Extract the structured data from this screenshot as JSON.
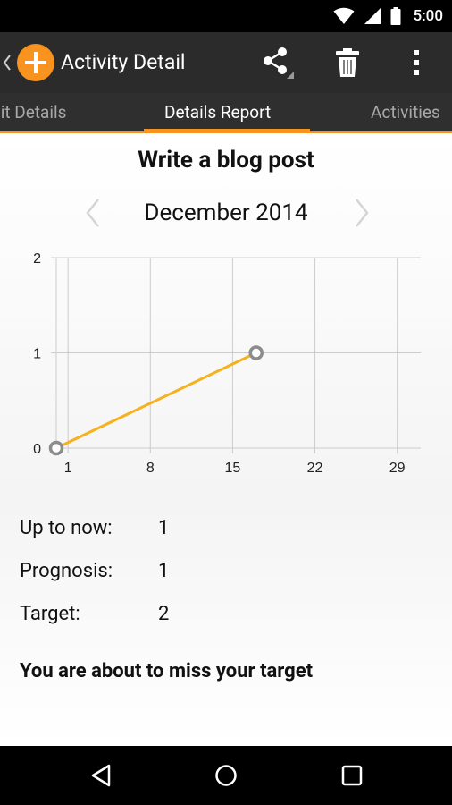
{
  "status_bar": {
    "time": "5:00",
    "icons": [
      "wifi-icon",
      "signal-icon",
      "battery-icon"
    ]
  },
  "action_bar": {
    "title": "Activity Detail",
    "icons": [
      "chevron-left-icon",
      "add-icon",
      "share-icon",
      "trash-icon",
      "overflow-menu-icon"
    ]
  },
  "tabs": [
    {
      "label": "Edit Details",
      "visible_text": "dit Details",
      "active": false
    },
    {
      "label": "Details Report",
      "active": true
    },
    {
      "label": "Activities",
      "active": false
    }
  ],
  "activity": {
    "title": "Write a blog post"
  },
  "period": {
    "label": "December 2014"
  },
  "chart_data": {
    "type": "line",
    "x_ticks": [
      "1",
      "8",
      "15",
      "22",
      "29"
    ],
    "y_ticks": [
      "0",
      "1",
      "2"
    ],
    "xlim": [
      0,
      31
    ],
    "ylim": [
      0,
      2
    ],
    "grid": true,
    "series": [
      {
        "color": "#f6b21d",
        "points": [
          {
            "x": 0,
            "y": 0
          },
          {
            "x": 17,
            "y": 1
          }
        ]
      }
    ]
  },
  "stats": [
    {
      "label": "Up to now:",
      "value": "1"
    },
    {
      "label": "Prognosis:",
      "value": "1"
    },
    {
      "label": "Target:",
      "value": "2"
    }
  ],
  "message": "You are about to miss your target",
  "colors": {
    "accent": "#f7931e",
    "line": "#f6b21d",
    "action_bar": "#2b2b2b",
    "tab_bar": "#2f2f2f"
  },
  "nav_bar": {
    "icons": [
      "back-icon",
      "home-icon",
      "recents-icon"
    ]
  }
}
